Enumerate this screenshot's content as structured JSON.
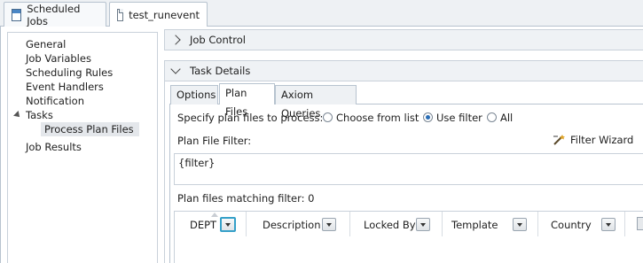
{
  "editor_tabs": [
    {
      "label": "Scheduled Jobs",
      "icon": "calendar-icon",
      "active": false
    },
    {
      "label": "test_runevent",
      "icon": "document-icon",
      "active": true
    }
  ],
  "tree": {
    "items": [
      {
        "label": "General"
      },
      {
        "label": "Job Variables"
      },
      {
        "label": "Scheduling Rules"
      },
      {
        "label": "Event Handlers"
      },
      {
        "label": "Notification"
      },
      {
        "label": "Tasks",
        "expanded": true
      },
      {
        "label": "Process Plan Files",
        "selected": true
      },
      {
        "label": "Job Results"
      }
    ]
  },
  "job_control": {
    "title": "Job Control",
    "expanded": false
  },
  "task_details": {
    "title": "Task Details",
    "expanded": true,
    "tabs": [
      {
        "label": "Options",
        "active": false
      },
      {
        "label": "Plan Files",
        "active": true
      },
      {
        "label": "Axiom Queries",
        "active": false
      }
    ],
    "specify_label": "Specify plan files to process:",
    "radio_options": [
      {
        "label": "Choose from list",
        "checked": false
      },
      {
        "label": "Use filter",
        "checked": true
      },
      {
        "label": "All",
        "checked": false
      }
    ],
    "filter_label": "Plan File Filter:",
    "filter_wizard_label": "Filter Wizard",
    "filter_value": "{filter}",
    "matching_label": "Plan files matching filter: 0",
    "columns": [
      {
        "label": "DEPT",
        "sorted": true
      },
      {
        "label": "Description"
      },
      {
        "label": "Locked By"
      },
      {
        "label": "Template"
      },
      {
        "label": "Country"
      }
    ]
  },
  "colors": {
    "accent": "#35a0c9",
    "selected_bg": "#e4e7eb",
    "header_bg": "#eff2f5",
    "border": "#b7c3cf"
  }
}
